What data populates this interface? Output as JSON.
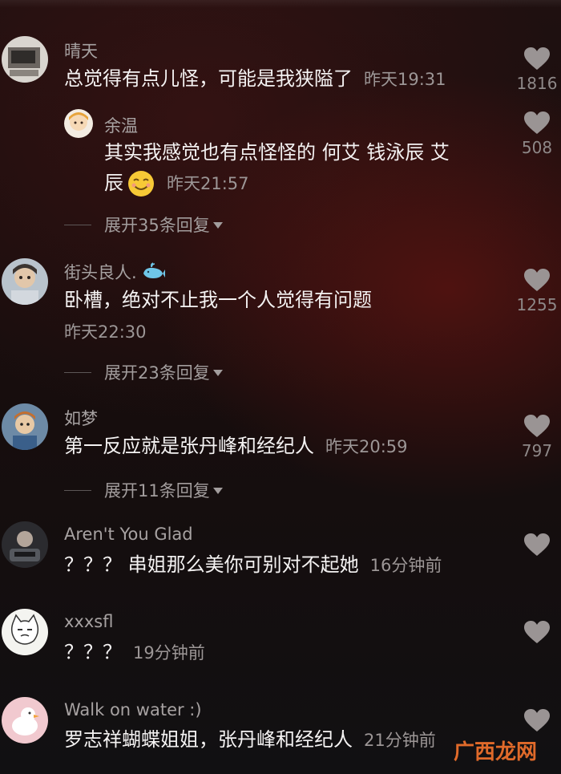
{
  "colors": {
    "username": "#a7a2a2",
    "time": "#9c9696",
    "like_icon": "#9a9494",
    "watermark": "#e06a2a"
  },
  "comments": [
    {
      "username": "晴天",
      "text": "总觉得有点儿怪，可能是我狭隘了",
      "time": "昨天19:31",
      "likes": "1816",
      "replies_label": "展开35条回复",
      "reply": {
        "username": "余温",
        "text_line1": "其实我感觉也有点怪怪的 何艾 钱泳辰 艾",
        "text_line2": "辰",
        "emoji": "smiling-face-icon",
        "time": "昨天21:57",
        "likes": "508"
      }
    },
    {
      "username": "街头良人.",
      "username_badge": "whale-icon",
      "text": "卧槽，绝对不止我一个人觉得有问题",
      "time": "昨天22:30",
      "likes": "1255",
      "replies_label": "展开23条回复"
    },
    {
      "username": "如梦",
      "text": "第一反应就是张丹峰和经纪人",
      "time": "昨天20:59",
      "likes": "797",
      "replies_label": "展开11条回复"
    },
    {
      "username": "Aren't You Glad",
      "text": "？？？ 串姐那么美你可别对不起她",
      "time": "16分钟前"
    },
    {
      "username": "xxxsfl",
      "text": "？？？",
      "time": "19分钟前"
    },
    {
      "username": "Walk on water :)",
      "text": "罗志祥蝴蝶姐姐，张丹峰和经纪人",
      "time": "21分钟前"
    }
  ],
  "watermark": "广西龙网"
}
